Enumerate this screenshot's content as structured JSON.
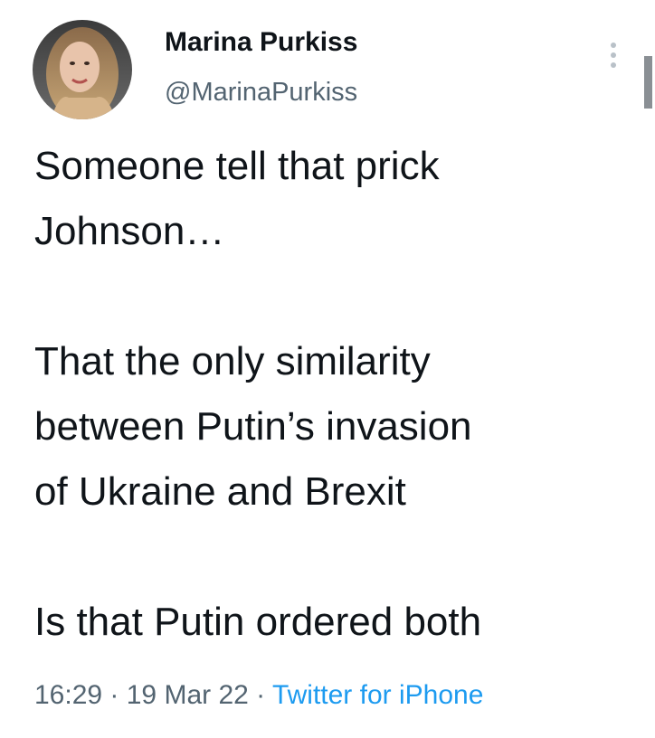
{
  "author": {
    "display_name": "Marina Purkiss",
    "handle": "@MarinaPurkiss"
  },
  "tweet": {
    "lines": [
      "Someone tell that prick",
      "Johnson…",
      "",
      "That the only similarity",
      "between Putin’s invasion",
      "of Ukraine and Brexit",
      "",
      "Is that Putin ordered both"
    ]
  },
  "meta": {
    "time": "16:29",
    "separator": " · ",
    "date": "19 Mar 22",
    "source": "Twitter for iPhone"
  },
  "icons": {
    "more": "more-vertical-icon"
  },
  "colors": {
    "text": "#0f1419",
    "secondary": "#536471",
    "link": "#1d9bf0"
  }
}
